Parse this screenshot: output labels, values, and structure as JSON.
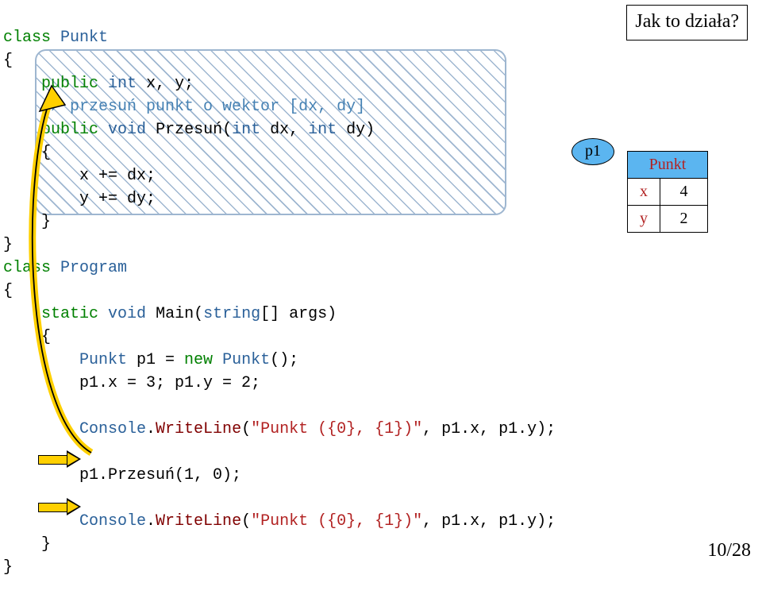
{
  "title_box": "Jak to działa?",
  "code": {
    "l1_class": "class",
    "l1_name": "Punkt",
    "l2_brace": "{",
    "l3_public": "public",
    "l3_int": "int",
    "l3_xy": " x, y;",
    "l4_comment": "// przesuń punkt o wektor [dx, dy]",
    "l5_public": "public",
    "l5_void": "void",
    "l5_przesun": " Przesuń(",
    "l5_int1": "int",
    "l5_dx": " dx, ",
    "l5_int2": "int",
    "l5_dy": " dy)",
    "l6_brace": "    {",
    "l7_body": "        x += dx;",
    "l8_body": "        y += dy;",
    "l9_brace": "    }",
    "l10_brace": "}",
    "l11_class": "class",
    "l11_name": "Program",
    "l12_brace": "{",
    "l13_static": "static",
    "l13_void": "void",
    "l13_main": " Main(",
    "l13_string": "string",
    "l13_args": "[] args)",
    "l14_brace": "    {",
    "l15_punkt": "Punkt",
    "l15_p1eq": " p1 = ",
    "l15_new": "new",
    "l15_ctor": " Punkt",
    "l15_paren": "();",
    "l16_assign": "        p1.x = 3; p1.y = 2;",
    "l17_blank": "",
    "l18_console": "Console",
    "l18_dot": ".",
    "l18_wl": "WriteLine",
    "l18_args": "(\"Punkt ({0}, {1})\", p1.x, p1.y);",
    "l18_str": "\"Punkt ({0}, {1})\"",
    "l18_rest": ", p1.x, p1.y);",
    "l19_blank": "",
    "l20_call": "        p1.Przesuń(1, 0);",
    "l21_blank": "",
    "l22_console": "Console",
    "l22_wl": "WriteLine",
    "l22_str": "\"Punkt ({0}, {1})\"",
    "l22_rest": ", p1.x, p1.y);",
    "l23_brace": "    }",
    "l24_brace": "}"
  },
  "obj": {
    "ref_label": "p1",
    "class_name": "Punkt",
    "field_x": "x",
    "field_y": "y",
    "val_x": "4",
    "val_y": "2"
  },
  "page_num": "10/28"
}
